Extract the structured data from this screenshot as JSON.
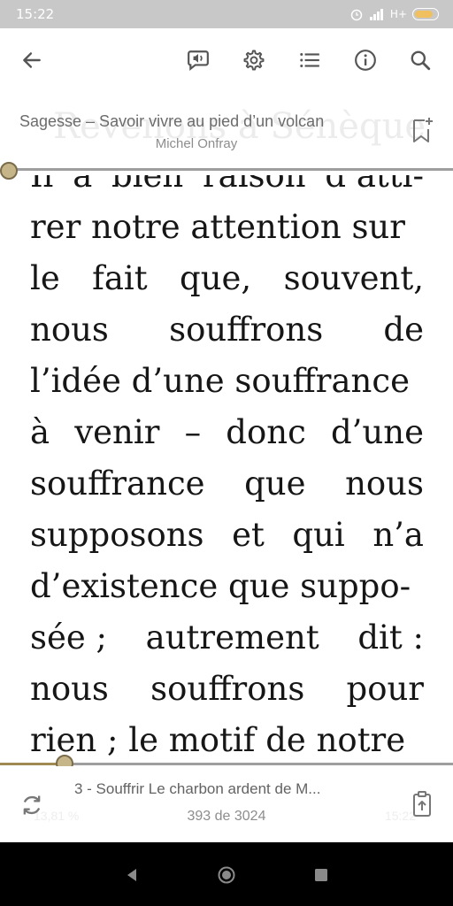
{
  "status_bar": {
    "time": "15:22",
    "network": "H+",
    "icons": [
      "alarm-icon",
      "signal-icon",
      "battery-icon"
    ],
    "battery_level": 0.85,
    "battery_color": "#f0c060"
  },
  "toolbar": {
    "icons": [
      "back-arrow-icon",
      "speak-icon",
      "gear-icon",
      "list-icon",
      "info-icon",
      "search-icon"
    ]
  },
  "book": {
    "title": "Sagesse – Savoir vivre au pied d’un volcan",
    "author": "Michel Onfray",
    "background_partial_text": "Revenons à Sénèque"
  },
  "reader": {
    "accent_color": "#a08a52",
    "top_partial_line": [
      "Il",
      "a",
      "bien",
      "raison",
      "d’atti-"
    ],
    "lines": [
      [
        "rer notre attention sur"
      ],
      [
        "le",
        "fait",
        "que,",
        "souvent,"
      ],
      [
        "nous",
        "souffrons",
        "de"
      ],
      [
        "l’idée d’une souffrance"
      ],
      [
        "à",
        "venir",
        "–",
        "donc",
        "d’une"
      ],
      [
        "souffrance",
        "que",
        "nous"
      ],
      [
        "supposons",
        "et",
        "qui",
        "n’a"
      ],
      [
        "d’existence que suppo-"
      ],
      [
        "sée ;",
        "autrement",
        "dit :"
      ],
      [
        "nous",
        "souffrons",
        "pour"
      ],
      [
        "rien ; le motif de notre"
      ]
    ]
  },
  "footer": {
    "chapter": "3 - Souffrir Le charbon ardent de M...",
    "page_count": "393 de 3024",
    "ghost_left": "13,81 %",
    "ghost_right": "15:22",
    "progress": 0.138
  }
}
